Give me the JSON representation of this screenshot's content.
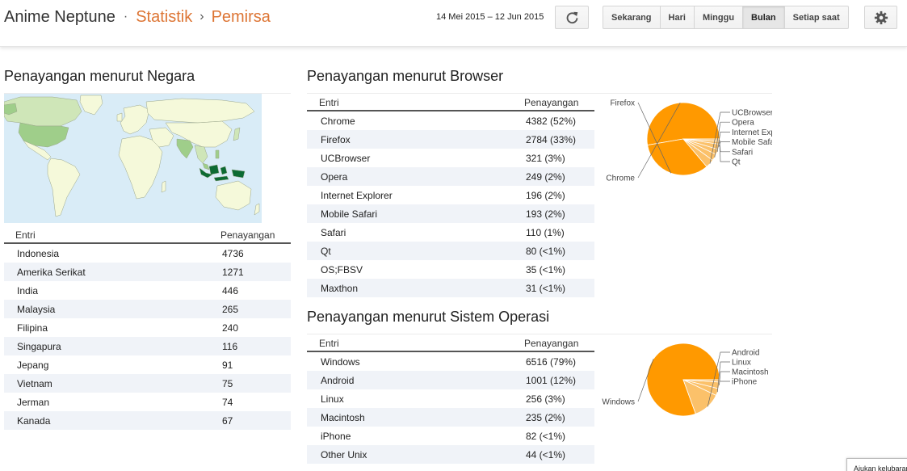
{
  "header": {
    "blog_name": "Anime Neptune",
    "separator_dot": "·",
    "separator_arrow": "›",
    "crumb_stats": "Statistik",
    "crumb_audience": "Pemirsa",
    "date_range": "14 Mei 2015 – 12 Jun 2015",
    "range_buttons": [
      "Sekarang",
      "Hari",
      "Minggu",
      "Bulan",
      "Setiap saat"
    ],
    "active_range": "Bulan",
    "refresh_icon": "refresh-icon",
    "settings_icon": "gear-icon"
  },
  "country": {
    "title": "Penayangan menurut Negara",
    "col_entry": "Entri",
    "col_views": "Penayangan",
    "rows": [
      {
        "entry": "Indonesia",
        "views": "4736"
      },
      {
        "entry": "Amerika Serikat",
        "views": "1271"
      },
      {
        "entry": "India",
        "views": "446"
      },
      {
        "entry": "Malaysia",
        "views": "265"
      },
      {
        "entry": "Filipina",
        "views": "240"
      },
      {
        "entry": "Singapura",
        "views": "116"
      },
      {
        "entry": "Jepang",
        "views": "91"
      },
      {
        "entry": "Vietnam",
        "views": "75"
      },
      {
        "entry": "Jerman",
        "views": "74"
      },
      {
        "entry": "Kanada",
        "views": "67"
      }
    ],
    "map_colors": {
      "ocean": "#d9ecf7",
      "land": "#f5f9da",
      "border": "#9aa58a",
      "low": "#cfe6b8",
      "mid": "#9fce8a",
      "high": "#0c6b33"
    }
  },
  "browser": {
    "title": "Penayangan menurut Browser",
    "col_entry": "Entri",
    "col_views": "Penayangan",
    "rows": [
      {
        "entry": "Chrome",
        "views": "4382 (52%)"
      },
      {
        "entry": "Firefox",
        "views": "2784 (33%)"
      },
      {
        "entry": "UCBrowser",
        "views": "321 (3%)"
      },
      {
        "entry": "Opera",
        "views": "249 (2%)"
      },
      {
        "entry": "Internet Explorer",
        "views": "196 (2%)"
      },
      {
        "entry": "Mobile Safari",
        "views": "193 (2%)"
      },
      {
        "entry": "Safari",
        "views": "110 (1%)"
      },
      {
        "entry": "Qt",
        "views": "80 (<1%)"
      },
      {
        "entry": "OS;FBSV",
        "views": "35 (<1%)"
      },
      {
        "entry": "Maxthon",
        "views": "31 (<1%)"
      }
    ],
    "pie": {
      "values": [
        4382,
        2784,
        321,
        249,
        196,
        193,
        110,
        80
      ],
      "labels": [
        "Chrome",
        "Firefox",
        "UCBrowser",
        "Opera",
        "Internet Explorer",
        "Mobile Safari",
        "Safari",
        "Qt"
      ]
    }
  },
  "os": {
    "title": "Penayangan menurut Sistem Operasi",
    "col_entry": "Entri",
    "col_views": "Penayangan",
    "rows": [
      {
        "entry": "Windows",
        "views": "6516 (79%)"
      },
      {
        "entry": "Android",
        "views": "1001 (12%)"
      },
      {
        "entry": "Linux",
        "views": "256 (3%)"
      },
      {
        "entry": "Macintosh",
        "views": "235 (2%)"
      },
      {
        "entry": "iPhone",
        "views": "82 (<1%)"
      },
      {
        "entry": "Other Unix",
        "views": "44 (<1%)"
      }
    ],
    "pie": {
      "values": [
        6516,
        1001,
        256,
        235,
        82
      ],
      "labels": [
        "Windows",
        "Android",
        "Linux",
        "Macintosh",
        "iPhone"
      ]
    }
  },
  "feedback": {
    "label": "Ajukan kelubaran"
  },
  "colors": {
    "accent": "#dd7534",
    "pie_main": "#ff9900",
    "pie_light": "#fbc16a",
    "alt_row": "#f0f3f8"
  }
}
